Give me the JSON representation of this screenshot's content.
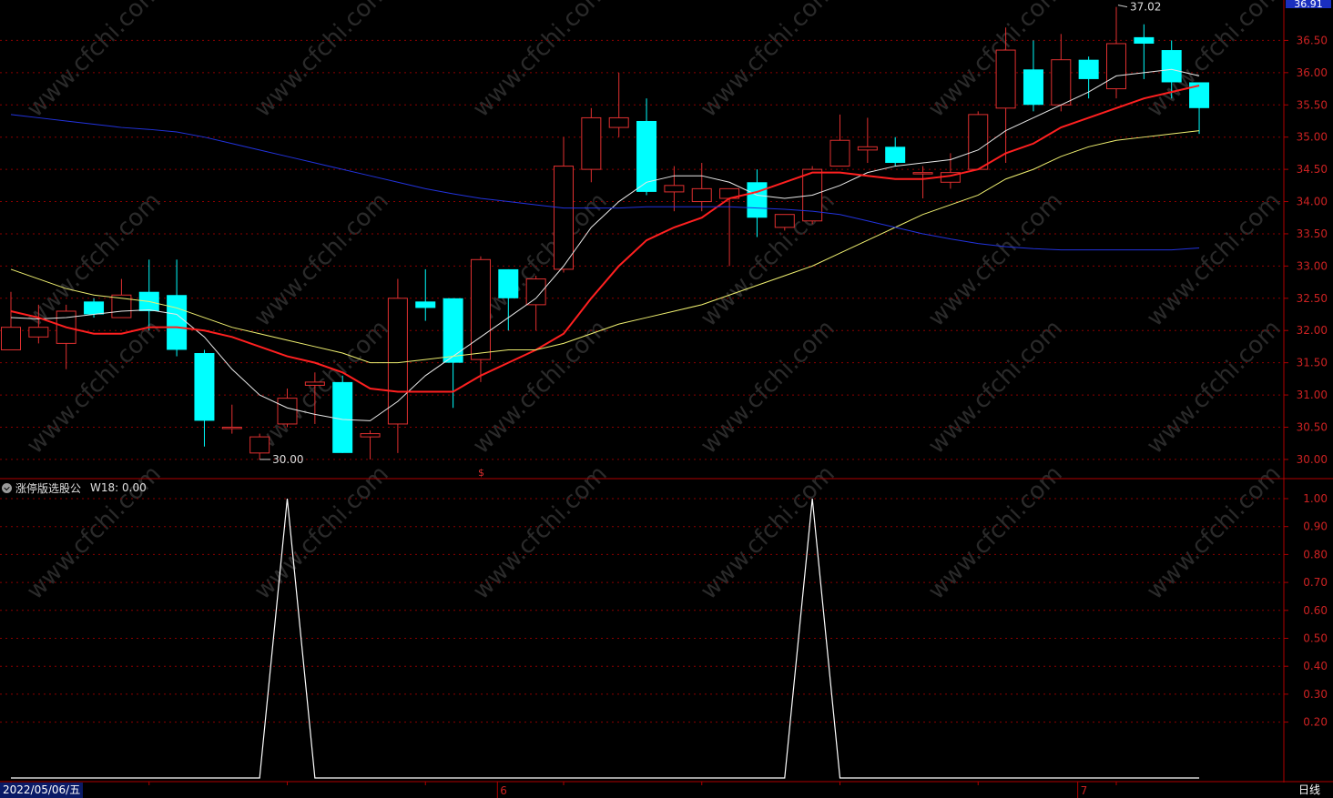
{
  "colors": {
    "background": "#000000",
    "grid": "#8b0000",
    "axis": "#b00000",
    "axis_text": "#cc2222",
    "up_candle": "#e03030",
    "down_candle": "#00ffff",
    "ma_white": "#e8e8e8",
    "ma_red": "#ff2020",
    "ma_yellow": "#f0f070",
    "ma_blue": "#2233dd",
    "indicator_line": "#ffffff",
    "watermark": "#2a2a2a"
  },
  "header": {
    "indicator_name": "涨停版选股公",
    "indicator_value": "W18: 0.00"
  },
  "footer": {
    "date_label": "2022/05/06/五",
    "period_label": "日线",
    "month_labels": [
      {
        "text": "6",
        "index": 18
      },
      {
        "text": "7",
        "index": 39
      }
    ]
  },
  "price_axis": {
    "current_box": "36.91",
    "ticks": [
      "36.50",
      "36.00",
      "35.50",
      "35.00",
      "34.50",
      "34.00",
      "33.50",
      "33.00",
      "32.50",
      "32.00",
      "31.50",
      "31.00",
      "30.50",
      "30.00"
    ]
  },
  "indicator_axis": {
    "ticks": [
      "1.00",
      "0.90",
      "0.80",
      "0.70",
      "0.60",
      "0.50",
      "0.40",
      "0.30",
      "0.20"
    ]
  },
  "annotations": {
    "high_label": "37.02",
    "low_label": "30.00",
    "marker": "$"
  },
  "watermark": "www.cfchi.com",
  "chart_data": [
    {
      "type": "candlestick",
      "ylim": [
        29.9,
        37.0
      ],
      "candles": [
        {
          "o": 31.7,
          "c": 32.05,
          "h": 32.6,
          "l": 31.7
        },
        {
          "o": 31.9,
          "c": 32.05,
          "h": 32.4,
          "l": 31.8
        },
        {
          "o": 31.8,
          "c": 32.3,
          "h": 32.4,
          "l": 31.4
        },
        {
          "o": 32.45,
          "c": 32.25,
          "h": 32.5,
          "l": 32.2
        },
        {
          "o": 32.2,
          "c": 32.55,
          "h": 32.8,
          "l": 32.2
        },
        {
          "o": 32.6,
          "c": 32.3,
          "h": 33.1,
          "l": 32.0
        },
        {
          "o": 32.55,
          "c": 31.7,
          "h": 33.1,
          "l": 31.6
        },
        {
          "o": 31.65,
          "c": 30.6,
          "h": 31.7,
          "l": 30.2
        },
        {
          "o": 30.5,
          "c": 30.5,
          "h": 30.85,
          "l": 30.4
        },
        {
          "o": 30.1,
          "c": 30.35,
          "h": 30.4,
          "l": 30.0
        },
        {
          "o": 30.55,
          "c": 30.95,
          "h": 31.1,
          "l": 30.5
        },
        {
          "o": 31.15,
          "c": 31.2,
          "h": 31.35,
          "l": 30.55
        },
        {
          "o": 31.2,
          "c": 30.1,
          "h": 31.3,
          "l": 30.1
        },
        {
          "o": 30.35,
          "c": 30.4,
          "h": 30.45,
          "l": 30.0
        },
        {
          "o": 30.55,
          "c": 32.5,
          "h": 32.8,
          "l": 30.1
        },
        {
          "o": 32.45,
          "c": 32.35,
          "h": 32.95,
          "l": 32.15
        },
        {
          "o": 32.5,
          "c": 31.5,
          "h": 32.5,
          "l": 30.8
        },
        {
          "o": 31.55,
          "c": 33.1,
          "h": 33.15,
          "l": 31.2
        },
        {
          "o": 32.95,
          "c": 32.5,
          "h": 32.95,
          "l": 32.0
        },
        {
          "o": 32.4,
          "c": 32.8,
          "h": 32.85,
          "l": 32.0
        },
        {
          "o": 32.95,
          "c": 34.55,
          "h": 35.0,
          "l": 32.9
        },
        {
          "o": 34.5,
          "c": 35.3,
          "h": 35.45,
          "l": 34.3
        },
        {
          "o": 35.15,
          "c": 35.3,
          "h": 36.0,
          "l": 35.0
        },
        {
          "o": 35.25,
          "c": 34.15,
          "h": 35.6,
          "l": 34.1
        },
        {
          "o": 34.15,
          "c": 34.25,
          "h": 34.55,
          "l": 33.85
        },
        {
          "o": 34.0,
          "c": 34.2,
          "h": 34.6,
          "l": 33.85
        },
        {
          "o": 34.05,
          "c": 34.2,
          "h": 34.2,
          "l": 33.0
        },
        {
          "o": 34.3,
          "c": 33.75,
          "h": 34.5,
          "l": 33.45
        },
        {
          "o": 33.6,
          "c": 33.8,
          "h": 33.8,
          "l": 33.55
        },
        {
          "o": 33.7,
          "c": 34.5,
          "h": 34.55,
          "l": 33.65
        },
        {
          "o": 34.55,
          "c": 34.95,
          "h": 35.35,
          "l": 34.55
        },
        {
          "o": 34.8,
          "c": 34.85,
          "h": 35.3,
          "l": 34.6
        },
        {
          "o": 34.85,
          "c": 34.6,
          "h": 35.0,
          "l": 34.55
        },
        {
          "o": 34.45,
          "c": 34.45,
          "h": 34.55,
          "l": 34.05
        },
        {
          "o": 34.3,
          "c": 34.45,
          "h": 34.75,
          "l": 34.2
        },
        {
          "o": 34.5,
          "c": 35.35,
          "h": 35.4,
          "l": 34.6
        },
        {
          "o": 35.45,
          "c": 36.35,
          "h": 36.7,
          "l": 34.6
        },
        {
          "o": 36.05,
          "c": 35.5,
          "h": 36.5,
          "l": 35.4
        },
        {
          "o": 35.5,
          "c": 36.2,
          "h": 36.6,
          "l": 35.4
        },
        {
          "o": 36.2,
          "c": 35.9,
          "h": 36.25,
          "l": 35.6
        },
        {
          "o": 35.75,
          "c": 36.45,
          "h": 37.02,
          "l": 35.6
        },
        {
          "o": 36.55,
          "c": 36.45,
          "h": 36.75,
          "l": 35.9
        },
        {
          "o": 36.35,
          "c": 35.85,
          "h": 36.5,
          "l": 35.6
        },
        {
          "o": 35.85,
          "c": 35.45,
          "h": 35.85,
          "l": 35.05
        }
      ],
      "series": [
        {
          "color_key": "ma_white",
          "values": [
            32.2,
            32.18,
            32.2,
            32.25,
            32.3,
            32.32,
            32.25,
            31.9,
            31.4,
            31.0,
            30.8,
            30.7,
            30.62,
            30.6,
            30.9,
            31.3,
            31.6,
            31.9,
            32.2,
            32.5,
            33.0,
            33.6,
            34.0,
            34.3,
            34.4,
            34.4,
            34.3,
            34.1,
            34.05,
            34.1,
            34.25,
            34.45,
            34.55,
            34.6,
            34.65,
            34.8,
            35.1,
            35.3,
            35.5,
            35.7,
            35.95,
            36.0,
            36.05,
            35.95
          ]
        },
        {
          "color_key": "ma_red",
          "values": [
            32.3,
            32.2,
            32.05,
            31.95,
            31.95,
            32.05,
            32.05,
            32.0,
            31.9,
            31.75,
            31.6,
            31.5,
            31.35,
            31.1,
            31.05,
            31.05,
            31.05,
            31.3,
            31.5,
            31.7,
            31.95,
            32.5,
            33.0,
            33.4,
            33.6,
            33.75,
            34.05,
            34.15,
            34.3,
            34.45,
            34.45,
            34.4,
            34.35,
            34.35,
            34.4,
            34.5,
            34.75,
            34.9,
            35.15,
            35.3,
            35.45,
            35.6,
            35.7,
            35.8
          ]
        },
        {
          "color_key": "ma_yellow",
          "values": [
            32.95,
            32.8,
            32.65,
            32.55,
            32.5,
            32.45,
            32.35,
            32.2,
            32.05,
            31.95,
            31.85,
            31.75,
            31.65,
            31.5,
            31.5,
            31.55,
            31.6,
            31.65,
            31.7,
            31.7,
            31.8,
            31.95,
            32.1,
            32.2,
            32.3,
            32.4,
            32.55,
            32.7,
            32.85,
            33.0,
            33.2,
            33.4,
            33.6,
            33.8,
            33.95,
            34.1,
            34.35,
            34.5,
            34.7,
            34.85,
            34.95,
            35.0,
            35.05,
            35.1
          ]
        },
        {
          "color_key": "ma_blue",
          "values": [
            35.35,
            35.3,
            35.25,
            35.2,
            35.15,
            35.12,
            35.08,
            35.0,
            34.9,
            34.8,
            34.7,
            34.6,
            34.5,
            34.4,
            34.3,
            34.2,
            34.12,
            34.05,
            34.0,
            33.95,
            33.9,
            33.9,
            33.9,
            33.92,
            33.92,
            33.92,
            33.92,
            33.9,
            33.88,
            33.85,
            33.8,
            33.7,
            33.6,
            33.5,
            33.42,
            33.35,
            33.3,
            33.27,
            33.25,
            33.25,
            33.25,
            33.25,
            33.25,
            33.28
          ]
        }
      ]
    },
    {
      "type": "line",
      "name": "W18",
      "ylim": [
        0,
        1.0
      ],
      "values": [
        0,
        0,
        0,
        0,
        0,
        0,
        0,
        0,
        0,
        0,
        1,
        0,
        0,
        0,
        0,
        0,
        0,
        0,
        0,
        0,
        0,
        0,
        0,
        0,
        0,
        0,
        0,
        0,
        0,
        1,
        0,
        0,
        0,
        0,
        0,
        0,
        0,
        0,
        0,
        0,
        0,
        0,
        0,
        0
      ]
    }
  ]
}
